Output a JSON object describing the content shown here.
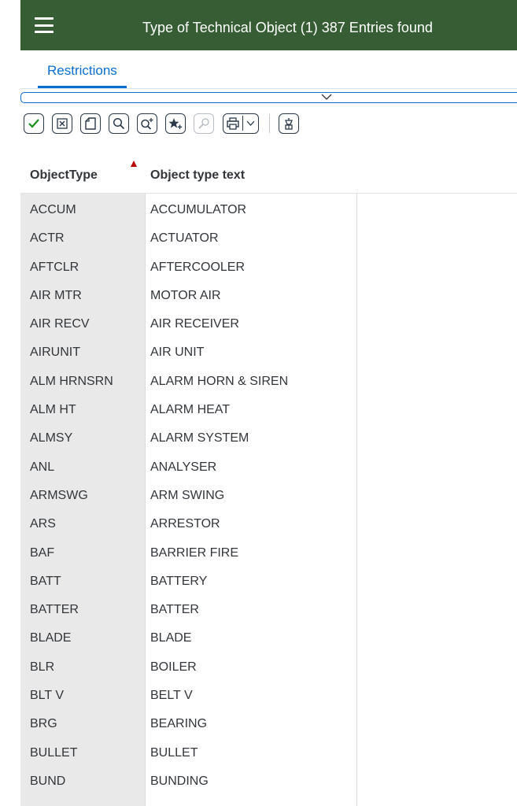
{
  "header": {
    "title": "Type of Technical Object (1)  387 Entries found"
  },
  "tabs": [
    {
      "label": "Restrictions"
    }
  ],
  "toolbar": {
    "buttons": [
      {
        "name": "confirm-icon",
        "color": "#1a8f1a"
      },
      {
        "name": "cancel-icon"
      },
      {
        "name": "new-document-icon"
      },
      {
        "name": "search-icon"
      },
      {
        "name": "search-plus-icon"
      },
      {
        "name": "add-favorite-icon"
      },
      {
        "name": "hint-icon"
      },
      {
        "name": "print-icon"
      },
      {
        "name": "dropdown-icon"
      },
      {
        "name": "hierarchy-icon"
      }
    ]
  },
  "table": {
    "columns": [
      "ObjectType",
      "Object type text"
    ],
    "sort": {
      "column": "ObjectType",
      "indicator_color": "#bb0000"
    },
    "rows": [
      [
        "ACCUM",
        "ACCUMULATOR"
      ],
      [
        "ACTR",
        "ACTUATOR"
      ],
      [
        "AFTCLR",
        "AFTERCOOLER"
      ],
      [
        "AIR MTR",
        "MOTOR AIR"
      ],
      [
        "AIR RECV",
        "AIR RECEIVER"
      ],
      [
        "AIRUNIT",
        "AIR UNIT"
      ],
      [
        "ALM HRNSRN",
        "ALARM HORN & SIREN"
      ],
      [
        "ALM HT",
        "ALARM HEAT"
      ],
      [
        "ALMSY",
        "ALARM SYSTEM"
      ],
      [
        "ANL",
        "ANALYSER"
      ],
      [
        "ARMSWG",
        "ARM SWING"
      ],
      [
        "ARS",
        "ARRESTOR"
      ],
      [
        "BAF",
        "BARRIER FIRE"
      ],
      [
        "BATT",
        "BATTERY"
      ],
      [
        "BATTER",
        "BATTER"
      ],
      [
        "BLADE",
        "BLADE"
      ],
      [
        "BLR",
        "BOILER"
      ],
      [
        "BLT V",
        "BELT V"
      ],
      [
        "BRG",
        "BEARING"
      ],
      [
        "BULLET",
        "BULLET"
      ],
      [
        "BUND",
        "BUNDING"
      ]
    ]
  },
  "colors": {
    "header_bg": "#375d35",
    "accent": "#0a6ed1",
    "key_column_bg": "#e9e9e9"
  }
}
